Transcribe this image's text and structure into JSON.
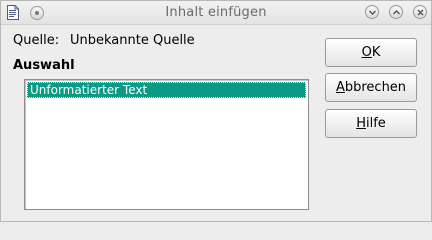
{
  "window": {
    "title": "Inhalt einfügen"
  },
  "source": {
    "label": "Quelle:",
    "value": "Unbekannte Quelle"
  },
  "selection": {
    "heading": "Auswahl",
    "items": [
      {
        "label": "Unformatierter Text",
        "selected": true
      }
    ]
  },
  "buttons": {
    "ok": {
      "mnemonic": "O",
      "rest": "K"
    },
    "cancel": {
      "mnemonic": "A",
      "rest": "bbrechen"
    },
    "help": {
      "mnemonic": "H",
      "rest": "ilfe"
    }
  },
  "colors": {
    "selection_highlight": "#0b9a83"
  }
}
